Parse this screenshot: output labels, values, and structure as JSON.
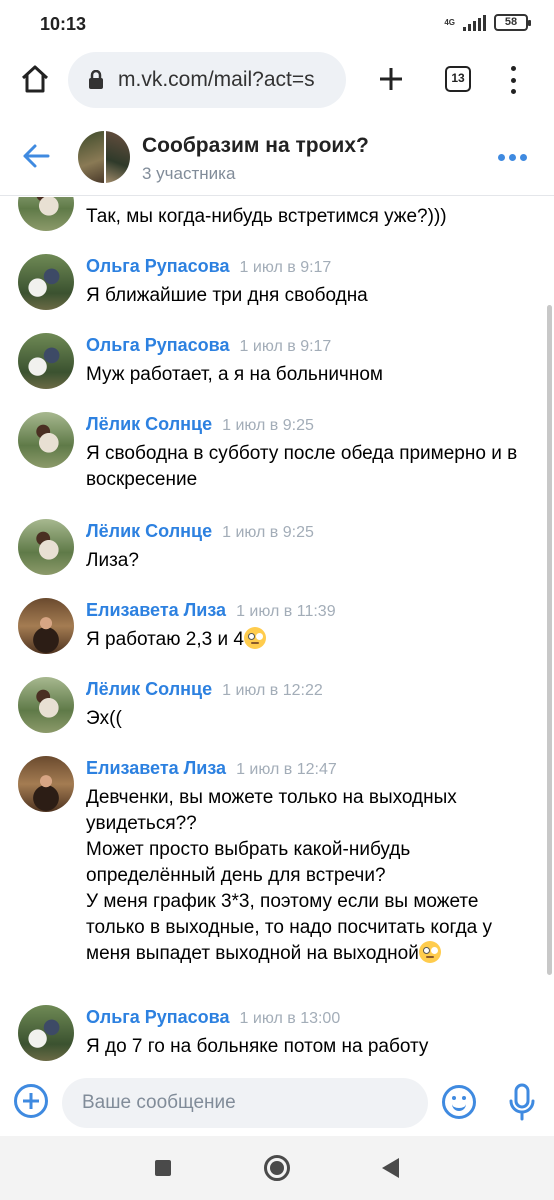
{
  "status_bar": {
    "time": "10:13",
    "network": "4G",
    "battery": "58"
  },
  "browser": {
    "url": "m.vk.com/mail?act=s",
    "tabs_count": "13"
  },
  "chat": {
    "title": "Сообразим на троих?",
    "subtitle": "3 участника"
  },
  "messages": [
    {
      "text": "Так, мы когда-нибудь встретимся уже?)))"
    },
    {
      "name": "Ольга Рупасова",
      "time": "1 июл в 9:17",
      "text": "Я ближайшие три дня свободна"
    },
    {
      "name": "Ольга Рупасова",
      "time": "1 июл в 9:17",
      "text": "Муж работает, а я на больничном"
    },
    {
      "name": "Лёлик Солнце",
      "time": "1 июл в 9:25",
      "text": "Я свободна в субботу после обеда примерно и в воскресение"
    },
    {
      "name": "Лёлик Солнце",
      "time": "1 июл в 9:25",
      "text": "Лиза?"
    },
    {
      "name": "Елизавета Лиза",
      "time": "1 июл в 11:39",
      "text": "Я работаю 2,3 и 4"
    },
    {
      "name": "Лёлик Солнце",
      "time": "1 июл в 12:22",
      "text": "Эх(("
    },
    {
      "name": "Елизавета Лиза",
      "time": "1 июл в 12:47",
      "text": "Девченки, вы можете только на выходных увидеться??\nМожет просто выбрать какой-нибудь определённый день для встречи?\nУ меня график 3*3, поэтому если вы можете только в выходные, то надо посчитать когда у меня выпадет выходной на выходной"
    },
    {
      "name": "Ольга Рупасова",
      "time": "1 июл в 13:00",
      "text": "Я до 7 го на больняке потом на работу"
    }
  ],
  "composer": {
    "placeholder": "Ваше сообщение"
  }
}
